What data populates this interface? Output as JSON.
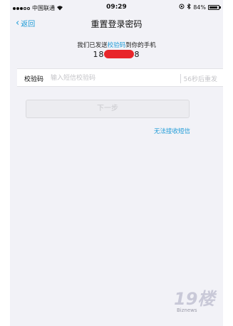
{
  "status_bar": {
    "carrier": "中国联通",
    "time": "09:29",
    "battery": "84%"
  },
  "nav": {
    "back_label": "返回",
    "title": "重置登录密码"
  },
  "message": {
    "prefix": "我们已发送",
    "highlight": "校验码",
    "suffix": "到你的手机",
    "phone_start": "18",
    "phone_end": "8"
  },
  "code_field": {
    "label": "校验码",
    "placeholder": "输入短信校验码",
    "resend": "56秒后重发"
  },
  "next_button": "下一步",
  "no_sms_link": "无法接收短信",
  "watermark": {
    "logo": "19楼",
    "text": "Biznews"
  },
  "colors": {
    "accent": "#1e9bd7",
    "background": "#f2f2f7",
    "disabled_text": "#c8c8cc"
  }
}
